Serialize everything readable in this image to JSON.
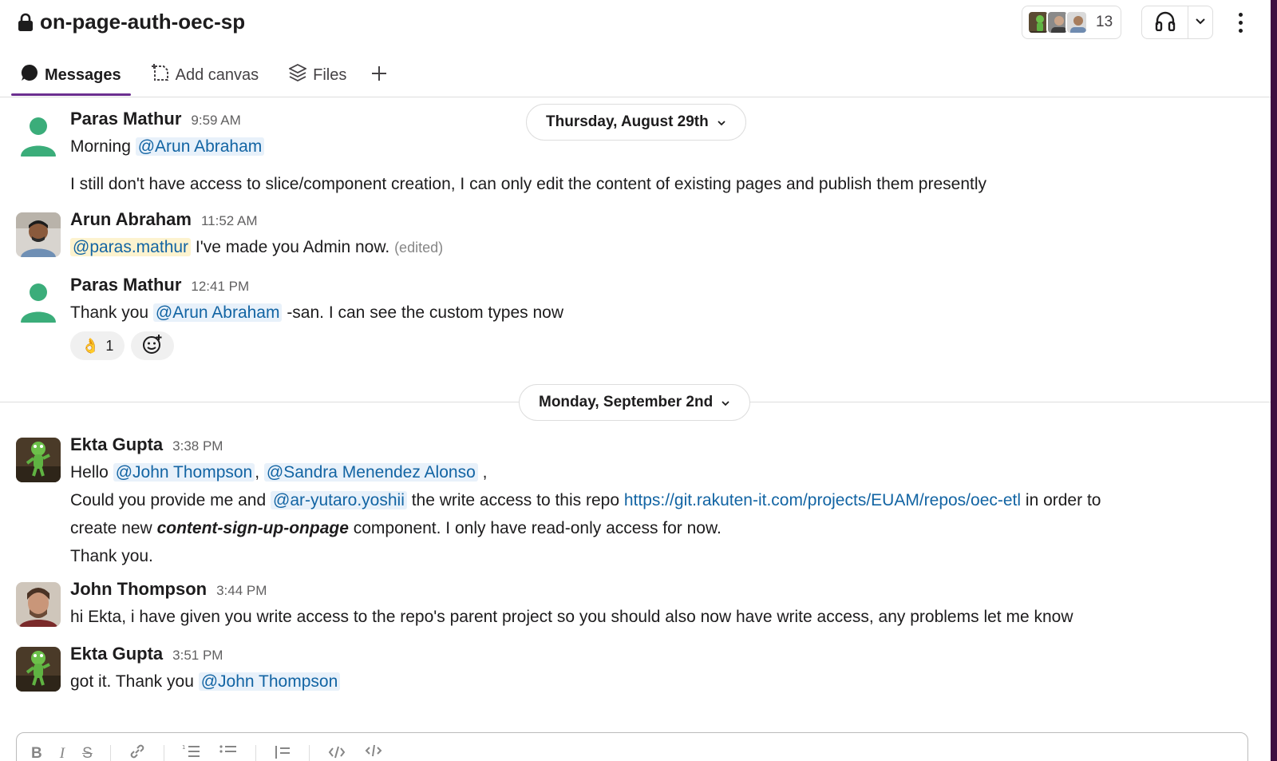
{
  "header": {
    "channel_name": "on-page-auth-oec-sp",
    "member_count": "13"
  },
  "tabs": [
    {
      "label": "Messages",
      "icon": "message-bubble-icon",
      "active": true
    },
    {
      "label": "Add canvas",
      "icon": "canvas-add-icon",
      "active": false
    },
    {
      "label": "Files",
      "icon": "files-layers-icon",
      "active": false
    }
  ],
  "dividers": [
    {
      "label": "Thursday, August 29th"
    },
    {
      "label": "Monday, September 2nd"
    }
  ],
  "messages": [
    {
      "author": "Paras Mathur",
      "time": "9:59 AM",
      "line1_pre": "Morning",
      "line1_mention": "@Arun Abraham",
      "line2": "I still don't have access to slice/component creation, I can only edit the content of existing pages and publish them presently"
    },
    {
      "author": "Arun Abraham",
      "time": "11:52 AM",
      "mention": "@paras.mathur",
      "text": "I've made you Admin now.",
      "edited": "(edited)"
    },
    {
      "author": "Paras Mathur",
      "time": "12:41 PM",
      "pre": "Thank you",
      "mention": "@Arun Abraham",
      "post": "-san. I can see the custom types now",
      "reaction_emoji": "👌",
      "reaction_count": "1"
    },
    {
      "author": "Ekta Gupta",
      "time": "3:38 PM",
      "l1_pre": "Hello",
      "l1_mention1": "@John Thompson",
      "l1_comma": ",",
      "l1_mention2": "@Sandra Menendez Alonso",
      "l1_end": ",",
      "l2_pre": "Could you provide me and",
      "l2_mention": "@ar-yutaro.yoshii",
      "l2_mid": "the write access to this repo",
      "l2_link": "https://git.rakuten-it.com/projects/EUAM/repos/oec-etl",
      "l2_end": "in order to",
      "l3_pre": "create  new",
      "l3_em": "content-sign-up-onpage",
      "l3_post": "component. I only have read-only access for now.",
      "l4": "Thank you."
    },
    {
      "author": "John Thompson",
      "time": "3:44 PM",
      "text": "hi Ekta, i have given you write access to the repo's parent project so you should also now have write access, any problems let me know"
    },
    {
      "author": "Ekta Gupta",
      "time": "3:51 PM",
      "pre": "got it. Thank you",
      "mention": "@John Thompson"
    }
  ],
  "composer": {
    "bold": "B",
    "italic": "I",
    "strike": "S"
  },
  "colors": {
    "accent": "#6b2f8f",
    "mention": "#1264a3",
    "mention_bg": "#e8f1fa",
    "self_mention_bg": "#fdf3cf",
    "default_avatar": "#3bad7a"
  }
}
